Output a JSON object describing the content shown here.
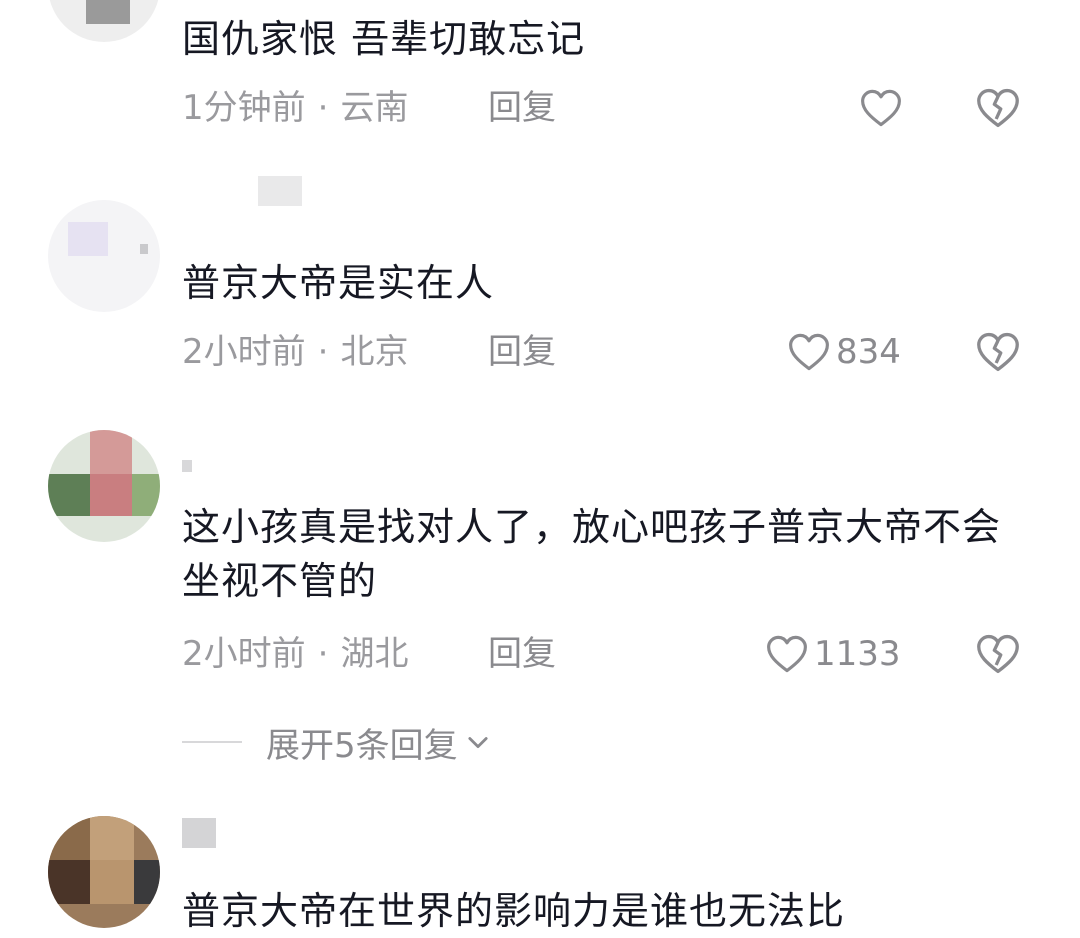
{
  "comments": [
    {
      "text": "国仇家恨 吾辈切敢忘记",
      "time": "1分钟前",
      "location": "云南",
      "reply_label": "回复",
      "likes": ""
    },
    {
      "text": "普京大帝是实在人",
      "time": "2小时前",
      "location": "北京",
      "reply_label": "回复",
      "likes": "834"
    },
    {
      "text": "这小孩真是找对人了，放心吧孩子普京大帝不会坐视不管的",
      "time": "2小时前",
      "location": "湖北",
      "reply_label": "回复",
      "likes": "1133"
    },
    {
      "text": "普京大帝在世界的影响力是谁也无法比",
      "time": "",
      "location": "",
      "reply_label": "",
      "likes": ""
    }
  ],
  "separator": "·",
  "expand_replies": "展开5条回复",
  "colors": {
    "text_primary": "#161823",
    "text_secondary": "#9a9a9e",
    "icon": "#8a8a8e"
  },
  "icons": [
    "heart-outline-icon",
    "broken-heart-icon",
    "chevron-down-icon"
  ]
}
